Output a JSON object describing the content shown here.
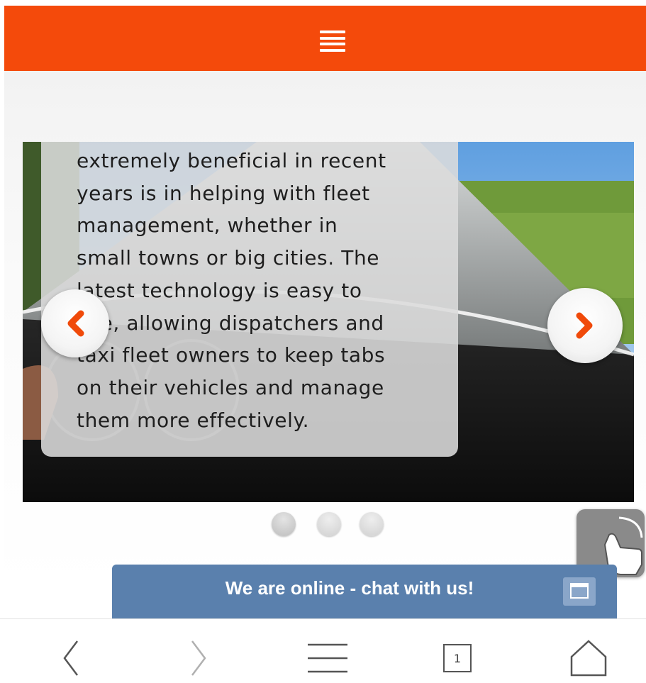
{
  "colors": {
    "accent": "#f44a0b",
    "chat_bar": "#5a80ad",
    "arrow": "#f04a0a"
  },
  "header": {
    "menu_icon": "hamburger-menu-icon"
  },
  "slider": {
    "caption_lines": [
      "extremely beneficial in recent",
      "years is in helping with fleet",
      "management, whether in",
      "small towns or big cities. The",
      "latest technology is easy to",
      "use, allowing dispatchers and",
      "taxi fleet owners to keep tabs",
      "on their vehicles and manage",
      "them more effectively."
    ],
    "prev_icon": "chevron-left-icon",
    "next_icon": "chevron-right-icon",
    "dots": 3,
    "active_dot": 0
  },
  "chat": {
    "label": "We are online - chat with us!",
    "icon": "window-icon"
  },
  "browser_nav": {
    "back_icon": "back-icon",
    "forward_icon": "forward-icon",
    "menu_icon": "menu-icon",
    "tab_count": "1",
    "home_icon": "home-icon"
  }
}
